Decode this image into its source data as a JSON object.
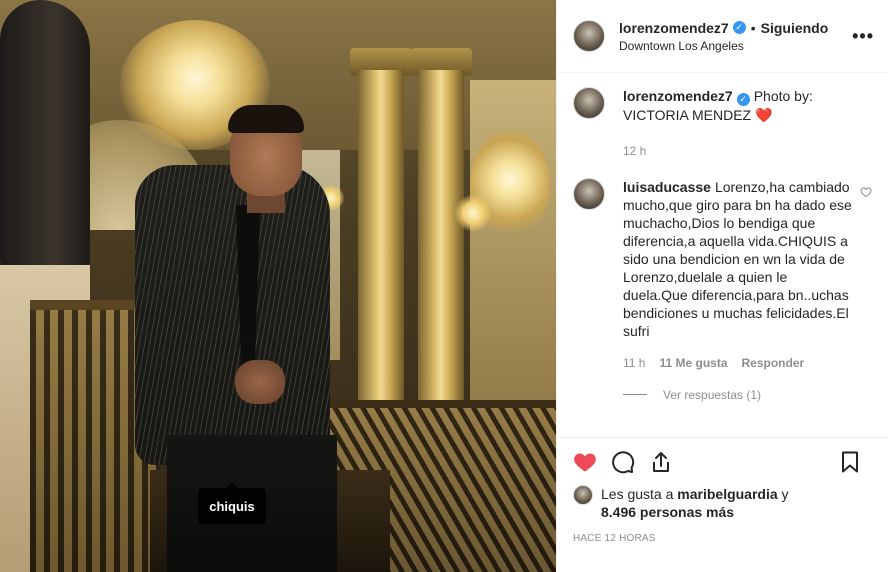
{
  "photo": {
    "tag_label": "chiquis"
  },
  "header": {
    "username": "lorenzomendez7",
    "verified": true,
    "separator": "•",
    "follow_status": "Siguiendo",
    "location": "Downtown Los Angeles",
    "more_icon": "more-horizontal-icon"
  },
  "caption": {
    "username": "lorenzomendez7",
    "text": "Photo by: VICTORIA MENDEZ",
    "emoji": "❤️",
    "time": "12 h"
  },
  "comment": {
    "username": "luisaducasse",
    "text": "Lorenzo,ha cambiado mucho,que giro para bn ha dado ese muchacho,Dios lo bendiga que diferencia,a aquella vida.CHIQUIS a sido una bendicion en wn la vida de Lorenzo,duelale a quien le duela.Que diferencia,para bn..uchas bendiciones u muchas felicidades.El sufri",
    "time": "11 h",
    "likes": "11 Me gusta",
    "reply_label": "Responder",
    "view_replies": "Ver respuestas (1)"
  },
  "actions": {
    "like_icon": "heart-filled-icon",
    "comment_icon": "comment-bubble-icon",
    "share_icon": "share-icon",
    "save_icon": "bookmark-icon",
    "like_color": "#ed4956"
  },
  "likes": {
    "prefix": "Les gusta a",
    "user": "maribelguardia",
    "conj": "y",
    "count": "8.496 personas más"
  },
  "timestamp": "HACE 12 HORAS",
  "colors": {
    "text": "#262626",
    "muted": "#8e8e8e",
    "border": "#efefef",
    "verified": "#3897f0",
    "like_red": "#ed4956"
  }
}
